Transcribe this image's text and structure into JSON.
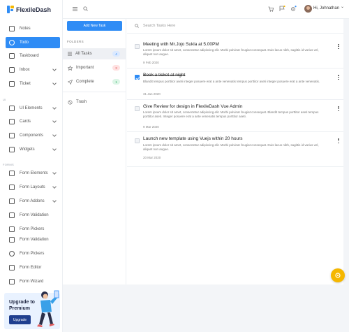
{
  "brand": {
    "name": "FlexileDash"
  },
  "header": {
    "user_greeting": "Hi, Johnathan",
    "dropdown_caret": "⌄"
  },
  "sidebar": {
    "items": [
      {
        "label": "Notes",
        "icon": "notes-icon"
      },
      {
        "label": "Todo",
        "icon": "todo-icon",
        "active": true
      },
      {
        "label": "Taskboard",
        "icon": "taskboard-icon"
      },
      {
        "label": "Inbox",
        "icon": "inbox-icon"
      },
      {
        "label": "Ticket",
        "icon": "ticket-icon"
      }
    ],
    "section_ui": "UI",
    "ui_items": [
      {
        "label": "UI Elements"
      },
      {
        "label": "Cards"
      },
      {
        "label": "Components"
      },
      {
        "label": "Widgets"
      }
    ],
    "section_forms": "FORMS",
    "form_items": [
      {
        "label": "Form Elements"
      },
      {
        "label": "Form Layouts"
      },
      {
        "label": "Form Addons"
      },
      {
        "label": "Form Validation"
      },
      {
        "label": "Form Pickers"
      },
      {
        "label": "Form Validation"
      },
      {
        "label": "Form Pickers"
      },
      {
        "label": "Form Editor"
      },
      {
        "label": "Form Wizard"
      }
    ],
    "upgrade": {
      "title": "Upgrade to Premium",
      "button": "Upgrade"
    }
  },
  "todo": {
    "add_button": "Add New Task",
    "folders_title": "FOLDERS",
    "folders": [
      {
        "label": "All Tasks",
        "count": "4",
        "badge_color": "#dbe9ff",
        "badge_text": "#2f8cf5"
      },
      {
        "label": "Important",
        "count": "3",
        "badge_color": "#ffe1e1",
        "badge_text": "#e05656"
      },
      {
        "label": "Complete",
        "count": "1",
        "badge_color": "#dcf5e6",
        "badge_text": "#2fae64"
      },
      {
        "label": "Trash"
      }
    ],
    "search_placeholder": "Search Tasks Here",
    "tasks": [
      {
        "title": "Meeting with Mr.Jojo Sukla at 5.00PM",
        "checked": false,
        "desc": "Lorem ipsum dolor sit amet, consectetur adipiscing elit. Morbi pulvinar feugiat consequat. Duis lacus nibh, sagittis id varius vel, aliquet non augue.",
        "date": "9 Feb 2020"
      },
      {
        "title": "Book a ticket at night",
        "checked": true,
        "desc": "Blandit tempus porttitor aseti integer posuere erat a ante venenatis tempus porttitor aseti integer posuere erat a ante venenatis.",
        "date": "31 Jan 2020"
      },
      {
        "title": "Give Review for design in FlexileDash Vue Admin",
        "checked": false,
        "desc": "Lorem ipsum dolor sit amet, consectetur adipiscing elit. Morbi pulvinar feugiat consequat. Blandit tempus porttitor aseti tempus porttitor aseti. Integer posuere erat a ante venenatis tempus porttitor aseti.",
        "date": "9 Mar 2020"
      },
      {
        "title": "Launch new template using Vuejs within 20 hours",
        "checked": false,
        "desc": "Lorem ipsum dolor sit amet, consectetur adipiscing elit. Morbi pulvinar feugiat consequat. Duis lacus nibh, sagittis id varius vel, aliquet non augue.",
        "date": "20 Mar 2020"
      }
    ]
  },
  "colors": {
    "primary": "#2f8cf5",
    "fab": "#f5b700"
  }
}
